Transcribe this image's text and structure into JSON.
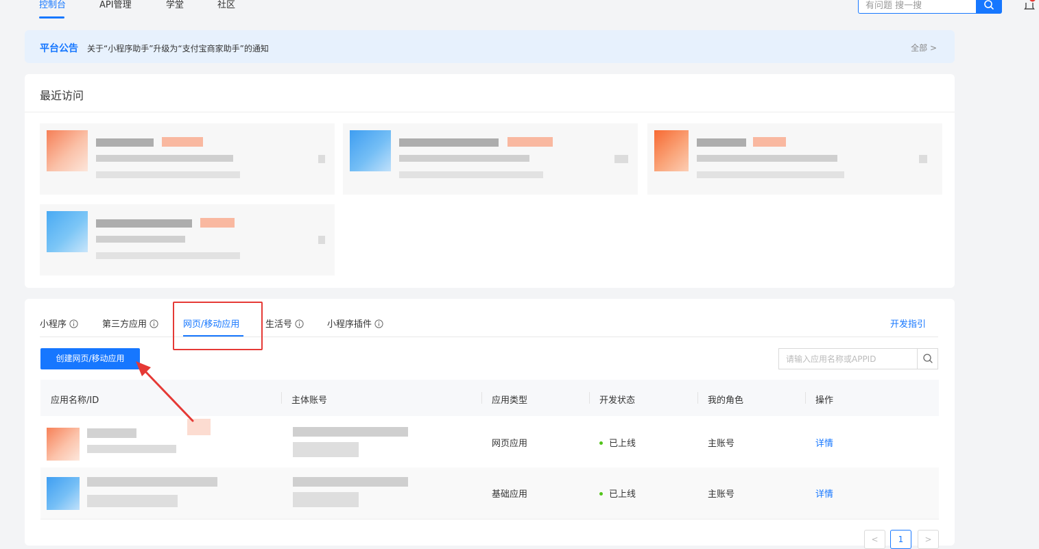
{
  "topnav": {
    "items": [
      {
        "label": "控制台",
        "active": true
      },
      {
        "label": "API管理",
        "active": false
      },
      {
        "label": "学堂",
        "active": false
      },
      {
        "label": "社区",
        "active": false
      }
    ],
    "search_placeholder": "有问题 搜一搜",
    "search_icon": "search-icon",
    "bell_icon": "bell-icon"
  },
  "notice": {
    "title": "平台公告",
    "text": "关于“小程序助手”升级为“支付宝商家助手”的通知",
    "more": "全部 >"
  },
  "recent": {
    "title": "最近访问"
  },
  "apps": {
    "tabs": [
      {
        "label": "小程序",
        "info": true,
        "active": false
      },
      {
        "label": "第三方应用",
        "info": true,
        "active": false
      },
      {
        "label": "网页/移动应用",
        "info": false,
        "active": true
      },
      {
        "label": "生活号",
        "info": true,
        "active": false
      },
      {
        "label": "小程序插件",
        "info": true,
        "active": false
      }
    ],
    "dev_guide": "开发指引",
    "create_button": "创建网页/移动应用",
    "search_placeholder": "请输入应用名称或APPID",
    "columns": [
      "应用名称/ID",
      "主体账号",
      "应用类型",
      "开发状态",
      "我的角色",
      "操作"
    ],
    "rows": [
      {
        "type": "网页应用",
        "status": "已上线",
        "role": "主账号",
        "action": "详情"
      },
      {
        "type": "基础应用",
        "status": "已上线",
        "role": "主账号",
        "action": "详情"
      }
    ],
    "pagination": {
      "prev": "<",
      "current": "1",
      "next": ">"
    }
  },
  "colors": {
    "accent": "#1677ff",
    "highlight": "#e53935",
    "status_online": "#52c41a"
  }
}
